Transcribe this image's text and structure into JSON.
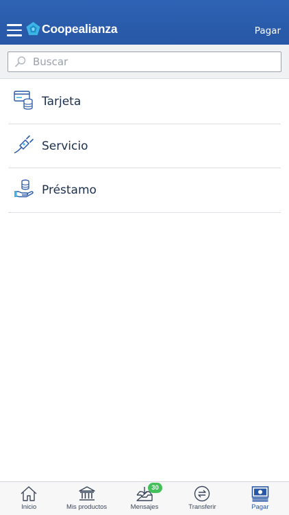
{
  "header": {
    "brand": "Coopealianza",
    "action": "Pagar",
    "colors": {
      "bar": "#2757a6",
      "logo_mark": "#3db4e6"
    }
  },
  "search": {
    "placeholder": "Buscar",
    "value": ""
  },
  "list": {
    "items": [
      {
        "label": "Tarjeta",
        "icon": "card-coins-icon"
      },
      {
        "label": "Servicio",
        "icon": "plug-icon"
      },
      {
        "label": "Préstamo",
        "icon": "hand-coins-icon"
      }
    ]
  },
  "bottom_nav": {
    "items": [
      {
        "label": "Inicio",
        "icon": "home-icon",
        "active": false
      },
      {
        "label": "Mis productos",
        "icon": "bank-icon",
        "active": false
      },
      {
        "label": "Mensajes",
        "icon": "inbox-icon",
        "badge": "30",
        "active": false
      },
      {
        "label": "Transferir",
        "icon": "transfer-icon",
        "active": false
      },
      {
        "label": "Pagar",
        "icon": "pay-icon",
        "active": true
      }
    ],
    "colors": {
      "active": "#2757a6",
      "badge": "#43c05a"
    }
  }
}
